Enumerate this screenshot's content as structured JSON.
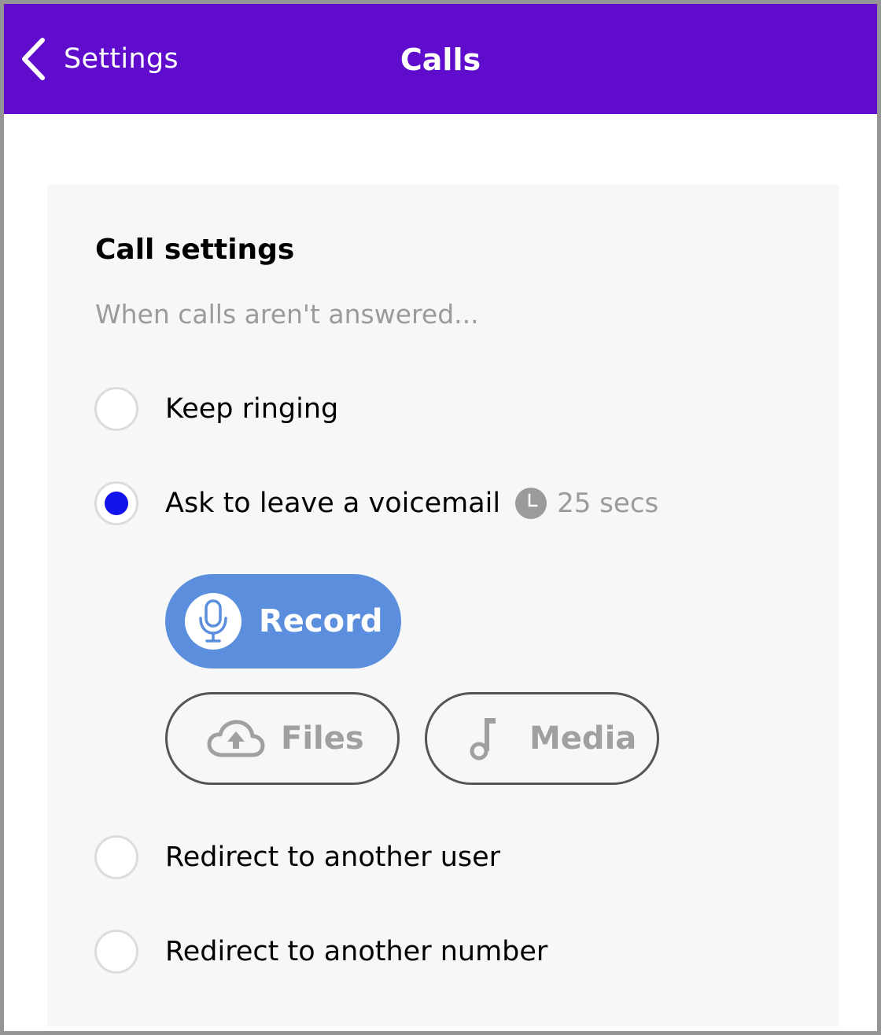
{
  "header": {
    "back_label": "Settings",
    "title": "Calls",
    "background": "#5f0ccc"
  },
  "panel": {
    "title": "Call settings",
    "subtitle": "When calls aren't answered..."
  },
  "options": [
    {
      "label": "Keep ringing",
      "selected": false
    },
    {
      "label": "Ask to leave a voicemail",
      "selected": true,
      "timer_text": "25 secs",
      "timer_icon": "clock-icon"
    },
    {
      "label": "Redirect to another user",
      "selected": false
    },
    {
      "label": "Redirect to another number",
      "selected": false
    }
  ],
  "voicemail_actions": {
    "record": {
      "label": "Record",
      "icon": "microphone-icon",
      "color": "#5b8fde"
    },
    "files": {
      "label": "Files",
      "icon": "cloud-upload-icon"
    },
    "media": {
      "label": "Media",
      "icon": "music-note-icon"
    }
  },
  "colors": {
    "accent": "#5f0ccc",
    "radio_selected": "#1212ea",
    "muted_text": "#9b9b9b"
  }
}
